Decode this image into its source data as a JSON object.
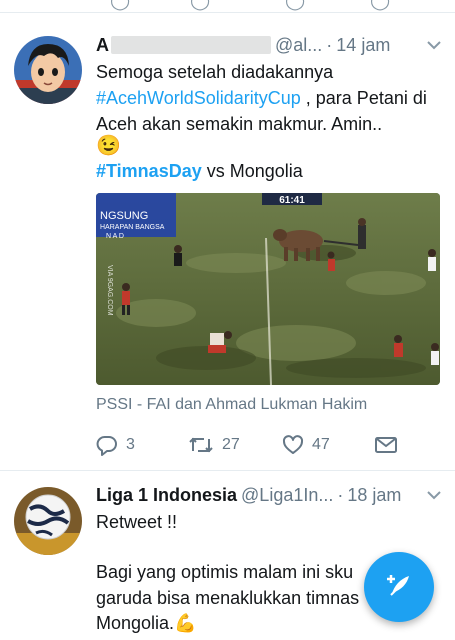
{
  "previous_tweet": {},
  "tweet1": {
    "display_name": "A",
    "handle": "@al...",
    "separator": "·",
    "time": "14 jam",
    "line1": "Semoga setelah diadakannya",
    "hashtag1": "#AcehWorldSolidarityCup",
    "line2_rest": " , para Petani di",
    "line3": "Aceh akan semakin makmur. Amin..",
    "emoji": "😉",
    "hashtag2": "#TimnasDay",
    "line5_rest": " vs Mongolia",
    "media": {
      "scoreboard": "61:41",
      "channel_line1": "NGSUNG",
      "channel_line2": "HARAPAN BANGSA",
      "channel_line3": "N A D",
      "watermark": "VIA 9GAG.COM"
    },
    "attribution": "PSSI - FAI dan Ahmad Lukman Hakim",
    "reply_count": "3",
    "retweet_count": "27",
    "like_count": "47"
  },
  "tweet2": {
    "display_name": "Liga 1 Indonesia",
    "handle": "@Liga1In...",
    "separator": "·",
    "time": "18 jam",
    "line1": "Retweet !!",
    "line2": "Bagi yang optimis malam ini sku",
    "line3": "garuda bisa menaklukkan timnas",
    "line4": "Mongolia.",
    "emoji": "💪"
  },
  "colors": {
    "accent": "#1da1f2",
    "secondary_text": "#657786",
    "divider": "#e6ecf0"
  },
  "icons": {
    "reply": "reply-icon",
    "retweet": "retweet-icon",
    "like": "heart-icon",
    "dm": "envelope-icon",
    "caret": "chevron-down-icon",
    "compose": "compose-tweet-icon"
  }
}
